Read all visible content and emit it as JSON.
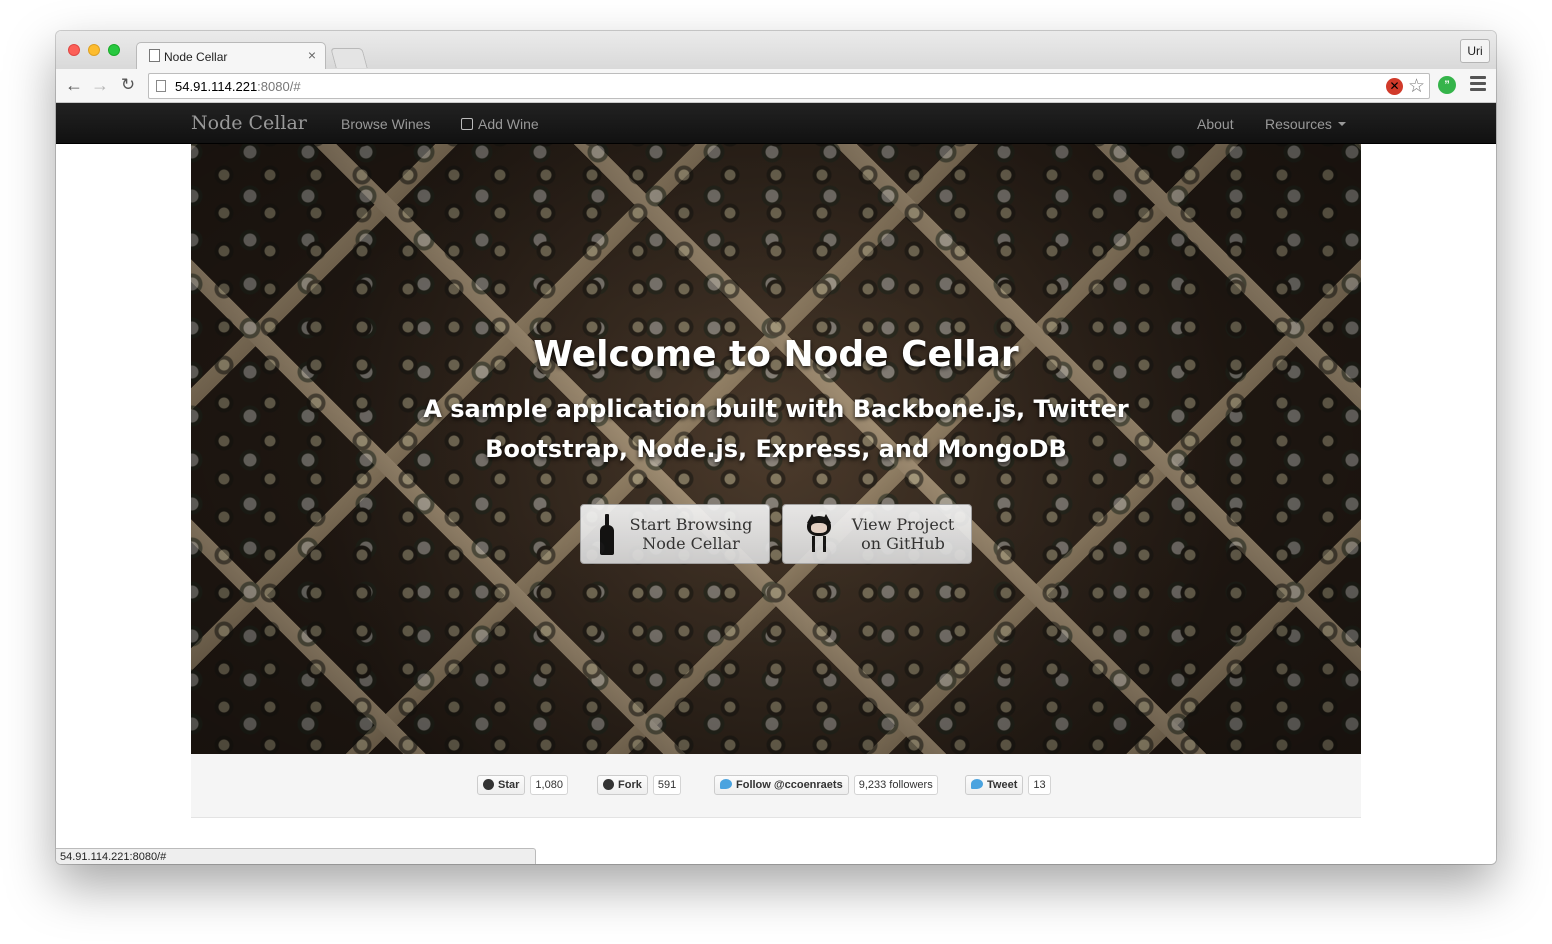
{
  "browser": {
    "tab_title": "Node Cellar",
    "tab_close": "×",
    "user_label": "Uri",
    "url_host": "54.91.114.221",
    "url_rest": ":8080/#",
    "back_icon": "arrow-left-icon",
    "forward_icon": "arrow-right-icon",
    "reload_icon": "reload-icon",
    "status_url": "54.91.114.221:8080/#"
  },
  "navbar": {
    "brand": "Node Cellar",
    "links": {
      "browse": "Browse Wines",
      "add": "Add Wine",
      "about": "About",
      "resources": "Resources"
    }
  },
  "hero": {
    "title": "Welcome to Node Cellar",
    "subtitle": "A sample application built with Backbone.js, Twitter Bootstrap, Node.js, Express, and MongoDB",
    "browse_button": {
      "line1": "Start Browsing",
      "line2": "Node Cellar"
    },
    "github_button": {
      "line1": "View Project",
      "line2": "on GitHub"
    }
  },
  "social": {
    "star": {
      "label": "Star",
      "count": "1,080"
    },
    "fork": {
      "label": "Fork",
      "count": "591"
    },
    "follow": {
      "label": "Follow @ccoenraets",
      "count": "9,233 followers"
    },
    "tweet": {
      "label": "Tweet",
      "count": "13"
    }
  },
  "colors": {
    "navbar_bg": "#1b1b1b",
    "nav_text": "#999999",
    "hero_text": "#ffffff",
    "twitter_blue": "#4aa3df"
  }
}
